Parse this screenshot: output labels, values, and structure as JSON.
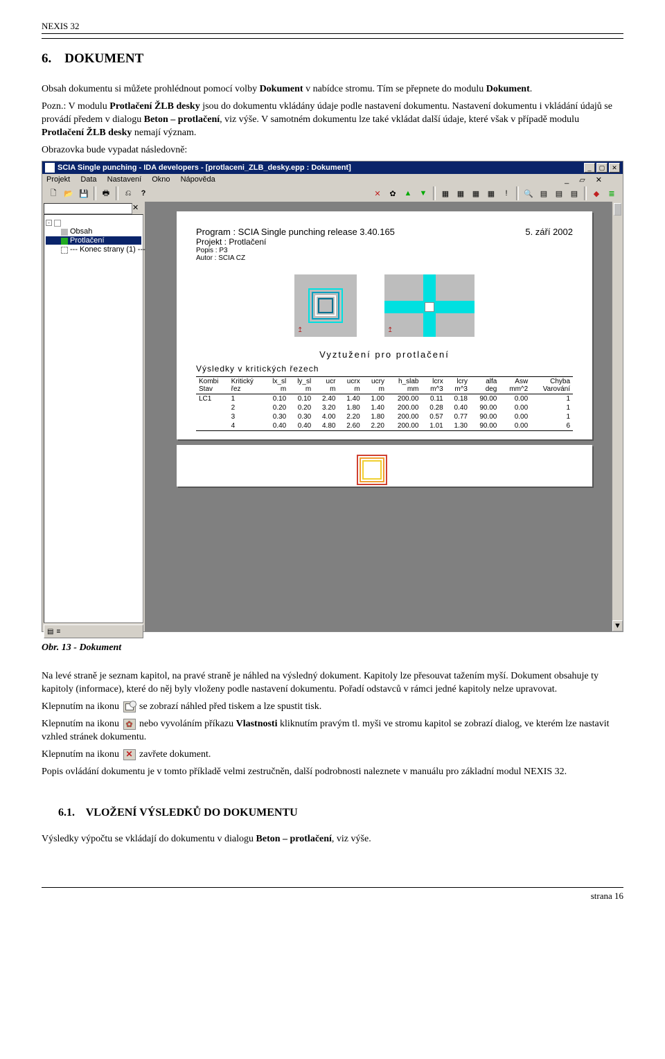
{
  "header": {
    "title": "NEXIS 32"
  },
  "section": {
    "num": "6.",
    "title": "DOKUMENT"
  },
  "intro": {
    "p1a": "Obsah dokumentu si můžete prohlédnout pomocí volby ",
    "p1b": "Dokument",
    "p1c": " v nabídce stromu. Tím se přepnete do modulu ",
    "p1d": "Dokument",
    "p1e": ".",
    "p2a": "Pozn.: V modulu ",
    "p2b": "Protlačení ŽLB desky",
    "p2c": " jsou do dokumentu vkládány údaje podle nastavení dokumentu. Nastavení dokumentu i vkládání údajů se provádí předem v dialogu ",
    "p2d": "Beton – protlačení",
    "p2e": ", viz výše. V samotném dokumentu lze také vkládat další údaje, které však v případě modulu ",
    "p2f": "Protlačení ŽLB desky",
    "p2g": " nemají význam.",
    "p3": "Obrazovka bude vypadat následovně:"
  },
  "shot": {
    "title": "SCIA Single punching - IDA developers - [protlaceni_ZLB_desky.epp : Dokument]",
    "menu": {
      "m1": "Projekt",
      "m2": "Data",
      "m3": "Nastavení",
      "m4": "Okno",
      "m5": "Nápověda"
    },
    "tree": {
      "i1": "Obsah",
      "i2": "Protlačení",
      "i3": "--- Konec strany (1) ---"
    },
    "page": {
      "prog": "Program  : SCIA Single punching release 3.40.165",
      "date": "5. září 2002",
      "proj": "Projekt  : Protlačení",
      "popis": "Popis : P3",
      "autor": "Autor : SCIA CZ",
      "title1": "Vyztužení  pro  protlačení",
      "title2": "Výsledky  v  kritických  řezech"
    }
  },
  "figcap": "Obr. 13 - Dokument",
  "body": {
    "p1": "Na levé straně je seznam kapitol, na pravé straně je náhled na výsledný dokument. Kapitoly lze přesouvat tažením myší. Dokument obsahuje ty kapitoly (informace), které do něj byly vloženy podle nastavení dokumentu. Pořadí odstavců v rámci jedné kapitoly nelze upravovat.",
    "p2a": "Klepnutím na ikonu ",
    "p2b": " se zobrazí náhled před tiskem a lze spustit tisk.",
    "p3a": "Klepnutím na ikonu ",
    "p3b": " nebo vyvoláním příkazu ",
    "p3c": "Vlastnosti",
    "p3d": " kliknutím pravým tl. myši ve stromu kapitol se zobrazí dialog, ve kterém lze nastavit vzhled stránek dokumentu.",
    "p4a": "Klepnutím na ikonu ",
    "p4b": " zavřete dokument.",
    "p5": "Popis ovládání dokumentu je v tomto příkladě velmi zestručněn, další podrobnosti naleznete v manuálu pro základní modul NEXIS 32."
  },
  "subsection": {
    "num": "6.1.",
    "title": "VLOŽENÍ VÝSLEDKŮ DO DOKUMENTU"
  },
  "sub_p_a": "Výsledky výpočtu se vkládají do dokumentu v dialogu ",
  "sub_p_b": "Beton – protlačení",
  "sub_p_c": ", viz výše.",
  "footer": "strana 16",
  "chart_data": {
    "type": "table",
    "title": "Výsledky v kritických řezech",
    "columns": [
      "Kombi Stav",
      "Kritický řez",
      "lx_sl m",
      "ly_sl m",
      "ucr m",
      "ucrx m",
      "ucry m",
      "h_slab mm",
      "lcrx m^3",
      "lcry m^3",
      "alfa deg",
      "Asw mm^2",
      "Chyba Varování"
    ],
    "rows": [
      [
        "LC1",
        "1",
        "0.10",
        "0.10",
        "2.40",
        "1.40",
        "1.00",
        "200.00",
        "0.11",
        "0.18",
        "90.00",
        "0.00",
        "1"
      ],
      [
        "",
        "2",
        "0.20",
        "0.20",
        "3.20",
        "1.80",
        "1.40",
        "200.00",
        "0.28",
        "0.40",
        "90.00",
        "0.00",
        "1"
      ],
      [
        "",
        "3",
        "0.30",
        "0.30",
        "4.00",
        "2.20",
        "1.80",
        "200.00",
        "0.57",
        "0.77",
        "90.00",
        "0.00",
        "1"
      ],
      [
        "",
        "4",
        "0.40",
        "0.40",
        "4.80",
        "2.60",
        "2.20",
        "200.00",
        "1.01",
        "1.30",
        "90.00",
        "0.00",
        "6"
      ]
    ]
  }
}
